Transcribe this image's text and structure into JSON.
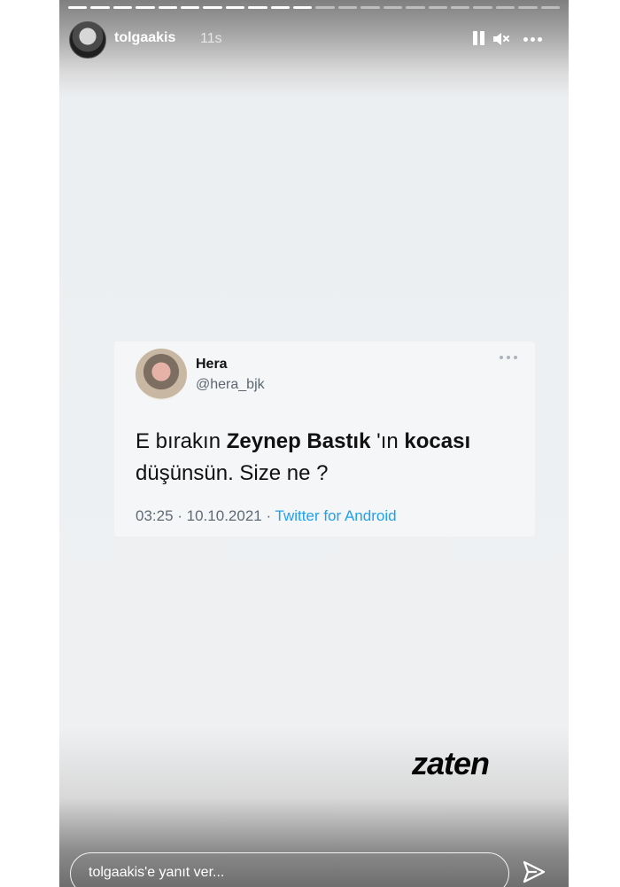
{
  "story": {
    "progress": {
      "total_segments": 22,
      "completed_segments": 11
    },
    "username": "tolgaakis",
    "time_ago": "11s",
    "icons": {
      "pause": "pause-icon",
      "mute": "mute-icon",
      "more": "more-icon",
      "send": "send-icon"
    }
  },
  "tweet": {
    "name": "Hera",
    "handle": "@hera_bjk",
    "text_parts": {
      "p1": "E bırakın ",
      "p2": "Zeynep Bastık",
      "p3": " 'ın ",
      "p4": "kocası",
      "p5": "düşünsün. Size ne ?"
    },
    "time": "03:25 · 10.10.2021 · ",
    "source": "Twitter for Android"
  },
  "sticker": {
    "text": "zaten"
  },
  "reply": {
    "placeholder": "tolgaakis'e yanıt ver..."
  }
}
